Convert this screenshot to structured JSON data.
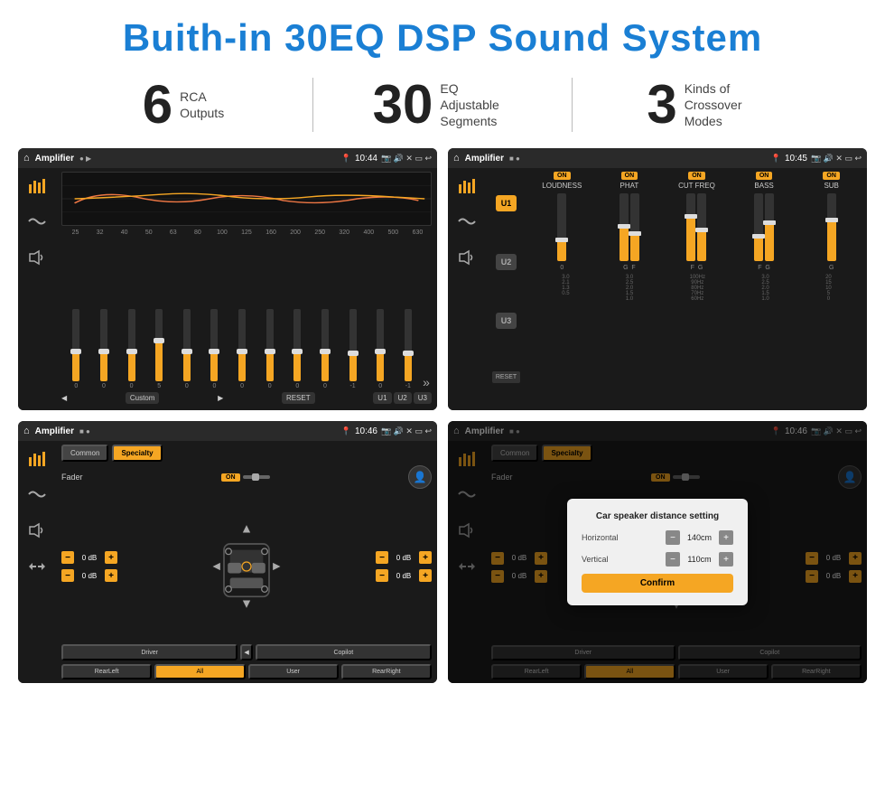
{
  "header": {
    "title": "Buith-in 30EQ DSP Sound System"
  },
  "stats": [
    {
      "number": "6",
      "desc_line1": "RCA",
      "desc_line2": "Outputs"
    },
    {
      "number": "30",
      "desc_line1": "EQ Adjustable",
      "desc_line2": "Segments"
    },
    {
      "number": "3",
      "desc_line1": "Kinds of",
      "desc_line2": "Crossover Modes"
    }
  ],
  "screenshots": {
    "eq": {
      "title": "Amplifier",
      "time": "10:44",
      "freqs": [
        "25",
        "32",
        "40",
        "50",
        "63",
        "80",
        "100",
        "125",
        "160",
        "200",
        "250",
        "320",
        "400",
        "500",
        "630"
      ],
      "values": [
        "0",
        "0",
        "0",
        "5",
        "0",
        "0",
        "0",
        "0",
        "0",
        "0",
        "-1",
        "0",
        "-1"
      ],
      "preset": "Custom",
      "buttons": [
        "RESET",
        "U1",
        "U2",
        "U3"
      ]
    },
    "crossover": {
      "title": "Amplifier",
      "time": "10:45",
      "units": [
        "U1",
        "U2",
        "U3"
      ],
      "channels": [
        {
          "label": "LOUDNESS",
          "on": true
        },
        {
          "label": "PHAT",
          "on": true
        },
        {
          "label": "CUT FREQ",
          "on": true
        },
        {
          "label": "BASS",
          "on": true
        },
        {
          "label": "SUB",
          "on": true
        }
      ]
    },
    "fader": {
      "title": "Amplifier",
      "time": "10:46",
      "tabs": [
        "Common",
        "Specialty"
      ],
      "fader_label": "Fader",
      "on_label": "ON",
      "db_values": [
        {
          "left": "0 dB",
          "right": "0 dB"
        },
        {
          "left": "0 dB",
          "right": "0 dB"
        }
      ],
      "footer_buttons": [
        "Driver",
        "",
        "Copilot",
        "RearLeft",
        "All",
        "User",
        "RearRight"
      ]
    },
    "distance": {
      "title": "Amplifier",
      "time": "10:46",
      "tabs": [
        "Common",
        "Specialty"
      ],
      "dialog": {
        "title": "Car speaker distance setting",
        "horizontal_label": "Horizontal",
        "horizontal_value": "140cm",
        "vertical_label": "Vertical",
        "vertical_value": "110cm",
        "confirm_label": "Confirm"
      },
      "db_values_right": [
        "0 dB",
        "0 dB"
      ],
      "footer_buttons": [
        "Driver",
        "Copilot",
        "RearLeft",
        "User",
        "RearRight"
      ]
    }
  }
}
